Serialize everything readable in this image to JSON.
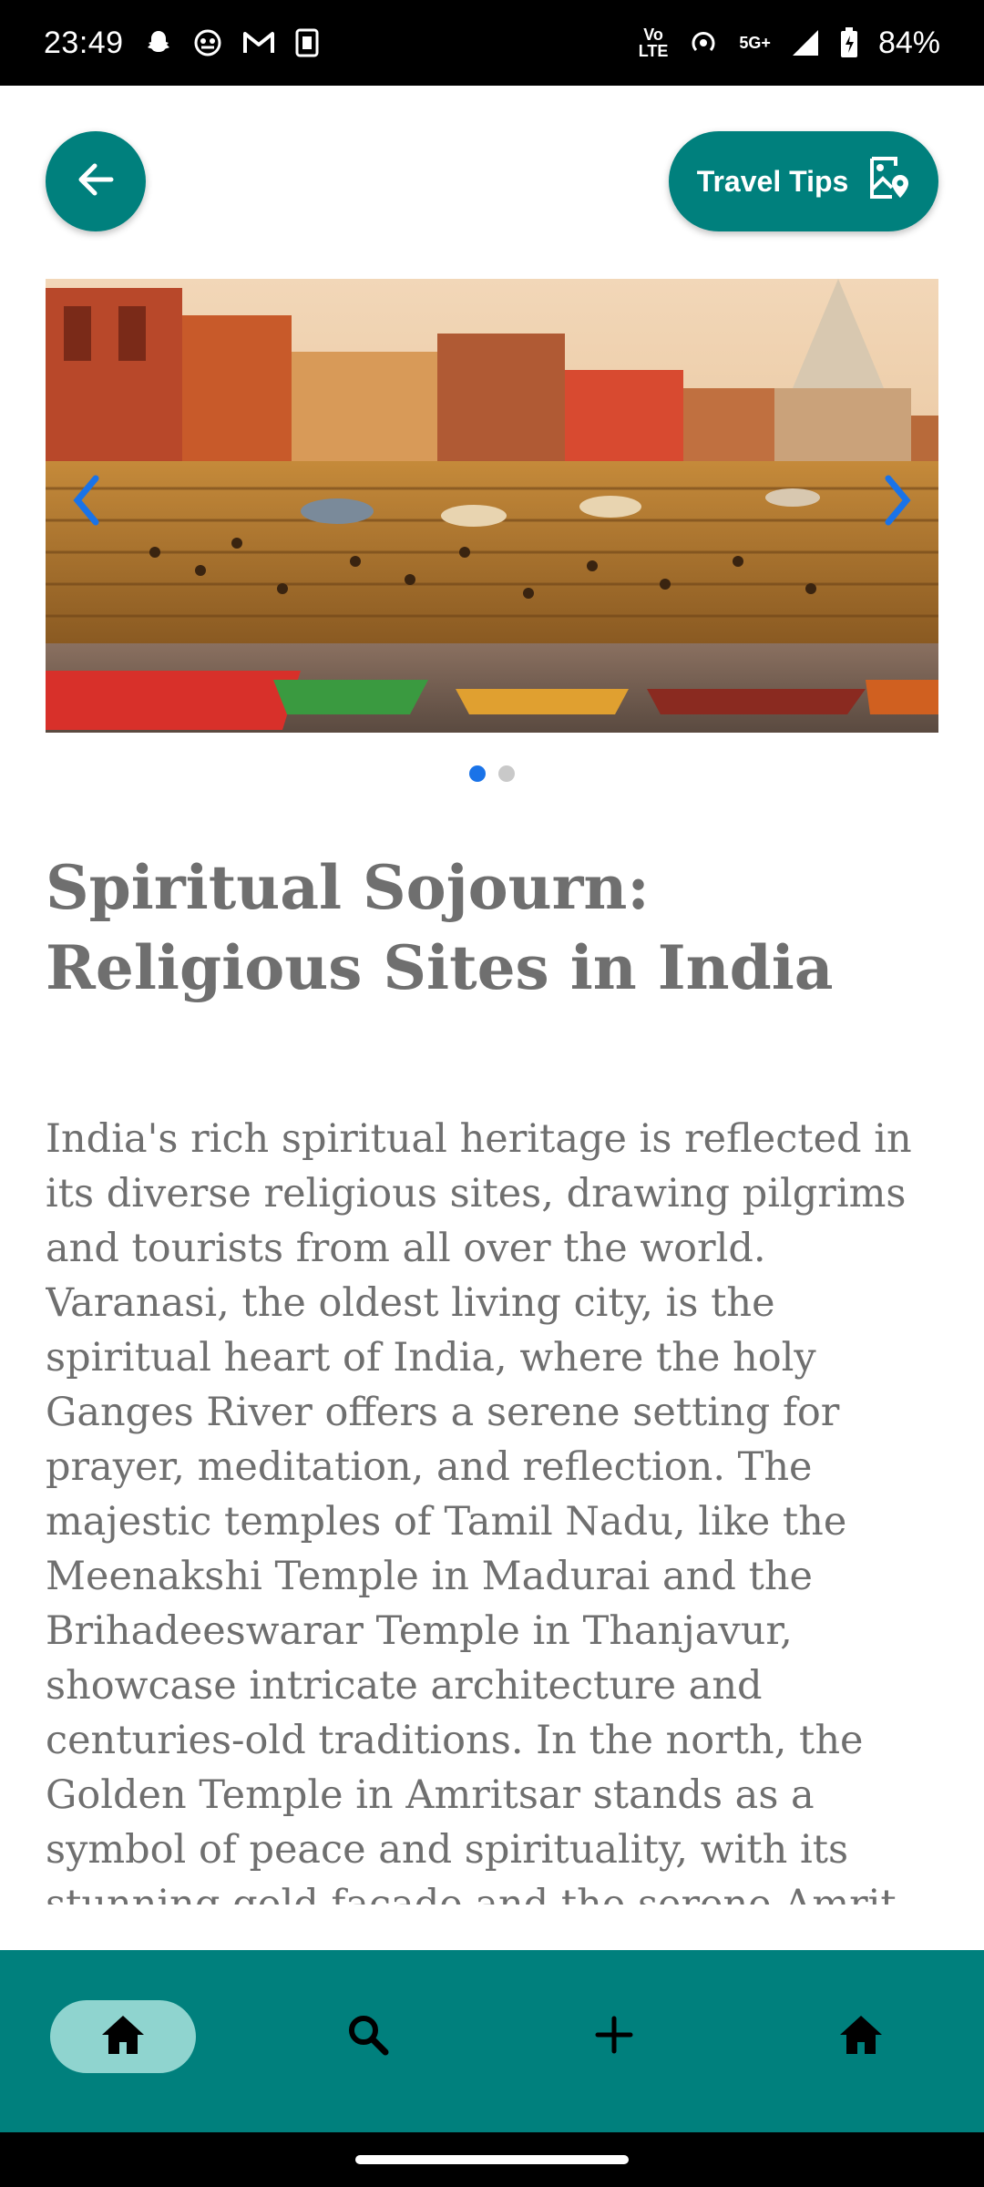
{
  "status_bar": {
    "time": "23:49",
    "icons_left": [
      "snapchat-icon",
      "ghost-app-icon",
      "gmail-icon",
      "sim-card-icon"
    ],
    "network_top": "Vo",
    "network_bottom": "LTE",
    "network_5g": "5G+",
    "battery": "84%"
  },
  "header": {
    "back_icon": "arrow-left-icon",
    "tips_label": "Travel Tips",
    "tips_icon": "map-pin-icon"
  },
  "carousel": {
    "image_subject": "Ghats of Varanasi with colorful boats on the Ganges",
    "slide_count": 2,
    "active_slide": 1
  },
  "article": {
    "title": "Spiritual Sojourn: Religious Sites in India",
    "body": "India's rich spiritual heritage is reflected in its diverse religious sites, drawing pilgrims and tourists from all over the world. Varanasi, the oldest living city, is the spiritual heart of India, where the holy Ganges River offers a serene setting for prayer, meditation, and reflection. The majestic temples of Tamil Nadu, like the Meenakshi Temple in Madurai and the Brihadeeswarar Temple in Thanjavur, showcase intricate architecture and centuries-old traditions. In the north, the Golden Temple in Amritsar stands as a symbol of peace and spirituality, with its stunning gold façade and the serene Amrit Sarovar. The sacred city of Haridwar, with its ghats and the evening Ganga"
  },
  "bottom_nav": {
    "items": [
      {
        "icon": "home-icon",
        "active": true
      },
      {
        "icon": "search-icon",
        "active": false
      },
      {
        "icon": "plus-icon",
        "active": false
      },
      {
        "icon": "home-icon",
        "active": false
      }
    ]
  },
  "colors": {
    "accent": "#00807d",
    "nav_active_pill": "#8fd4cf",
    "dot_active": "#1a73e8",
    "text": "#6f6f6f"
  }
}
